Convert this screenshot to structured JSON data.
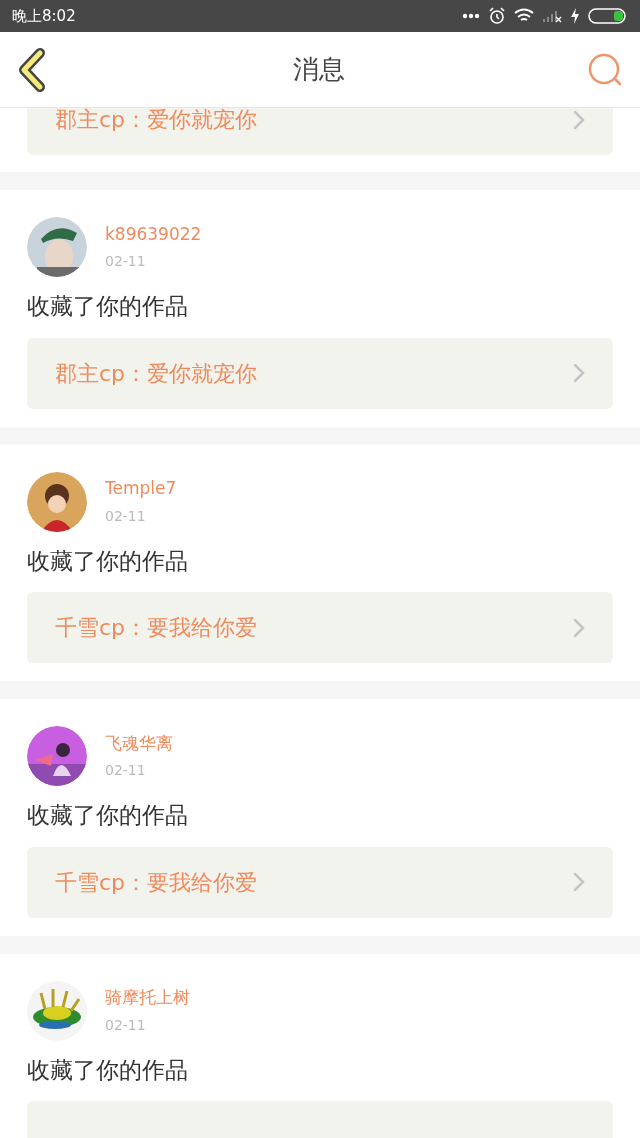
{
  "status_bar": {
    "time": "晚上8:02"
  },
  "header": {
    "title": "消息"
  },
  "top_link": {
    "text": "郡主cp：爱你就宠你"
  },
  "messages": [
    {
      "user": "k89639022",
      "date": "02-11",
      "action": "收藏了你的作品",
      "link": "郡主cp：爱你就宠你"
    },
    {
      "user": "Temple7",
      "date": "02-11",
      "action": "收藏了你的作品",
      "link": "千雪cp：要我给你爱"
    },
    {
      "user": "飞魂华离",
      "date": "02-11",
      "action": "收藏了你的作品",
      "link": "千雪cp：要我给你爱"
    },
    {
      "user": "骑摩托上树",
      "date": "02-11",
      "action": "收藏了你的作品"
    }
  ]
}
